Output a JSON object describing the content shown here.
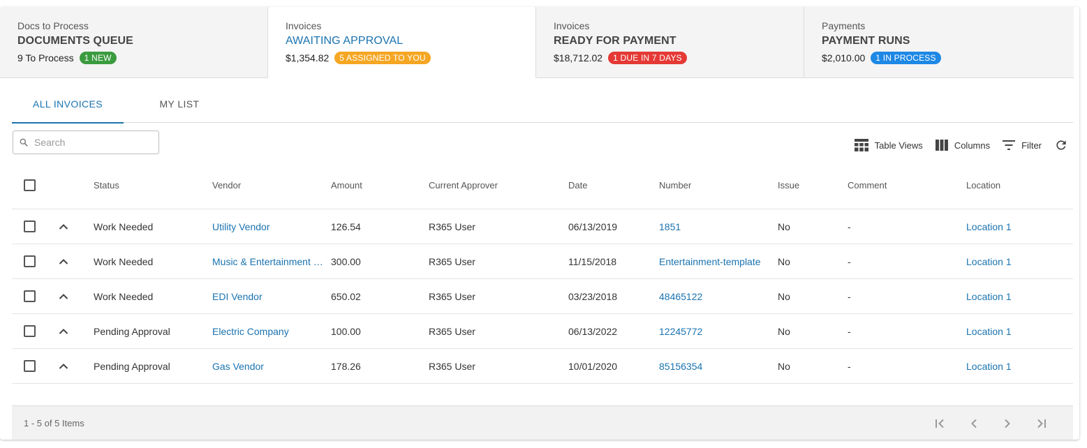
{
  "colors": {
    "accent": "#1a73b0",
    "badge_green": "#3b9b3f",
    "badge_orange": "#f5a623",
    "badge_red": "#e53935",
    "badge_blue": "#1e88e5"
  },
  "tiles": [
    {
      "label": "Docs to Process",
      "title": "DOCUMENTS QUEUE",
      "value": "9 To Process",
      "badge": "1 NEW",
      "badge_color": "#3b9b3f"
    },
    {
      "label": "Invoices",
      "title": "AWAITING APPROVAL",
      "value": "$1,354.82",
      "badge": "5 ASSIGNED TO YOU",
      "badge_color": "#f5a623"
    },
    {
      "label": "Invoices",
      "title": "READY FOR PAYMENT",
      "value": "$18,712.02",
      "badge": "1 DUE IN 7 DAYS",
      "badge_color": "#e53935"
    },
    {
      "label": "Payments",
      "title": "PAYMENT RUNS",
      "value": "$2,010.00",
      "badge": "1 IN PROCESS",
      "badge_color": "#1e88e5"
    }
  ],
  "subtabs": [
    "ALL INVOICES",
    "MY LIST"
  ],
  "search": {
    "placeholder": "Search"
  },
  "toolbar": {
    "table_views": "Table Views",
    "columns": "Columns",
    "filter": "Filter"
  },
  "table": {
    "headers": {
      "status": "Status",
      "vendor": "Vendor",
      "amount": "Amount",
      "approver": "Current Approver",
      "date": "Date",
      "number": "Number",
      "issue": "Issue",
      "comment": "Comment",
      "location": "Location"
    },
    "rows": [
      {
        "status": "Work Needed",
        "vendor": "Utility Vendor",
        "amount": "126.54",
        "approver": "R365 User",
        "date": "06/13/2019",
        "number": "1851",
        "issue": "No",
        "comment": "-",
        "location": "Location 1"
      },
      {
        "status": "Work Needed",
        "vendor": "Music & Entertainment Vendor",
        "amount": "300.00",
        "approver": "R365 User",
        "date": "11/15/2018",
        "number": "Entertainment-template",
        "issue": "No",
        "comment": "-",
        "location": "Location 1"
      },
      {
        "status": "Work Needed",
        "vendor": "EDI Vendor",
        "amount": "650.02",
        "approver": "R365 User",
        "date": "03/23/2018",
        "number": "48465122",
        "issue": "No",
        "comment": "-",
        "location": "Location 1"
      },
      {
        "status": "Pending Approval",
        "vendor": "Electric Company",
        "amount": "100.00",
        "approver": "R365 User",
        "date": "06/13/2022",
        "number": "12245772",
        "issue": "No",
        "comment": "-",
        "location": "Location 1"
      },
      {
        "status": "Pending Approval",
        "vendor": "Gas Vendor",
        "amount": "178.26",
        "approver": "R365 User",
        "date": "10/01/2020",
        "number": "85156354",
        "issue": "No",
        "comment": "-",
        "location": "Location 1"
      }
    ]
  },
  "footer": {
    "items_text": "1 - 5 of 5 Items"
  }
}
